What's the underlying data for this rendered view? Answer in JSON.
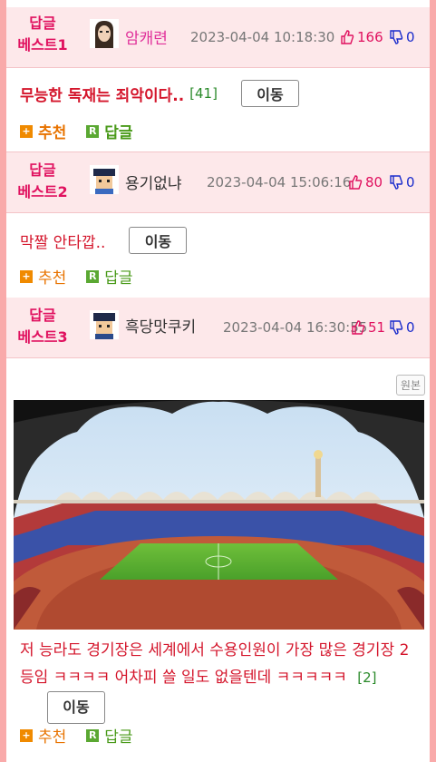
{
  "posts": [
    {
      "rank": [
        "답글",
        "베스트1"
      ],
      "nick": "암캐련",
      "date": "2023-04-04 10:18:30",
      "likes": "166",
      "dislikes": "0",
      "title": "무능한 독재는 죄악이다..",
      "comment_count": "[41]",
      "move_label": "이동",
      "recommend_label": "추천",
      "reply_label": "답글"
    },
    {
      "rank": [
        "답글",
        "베스트2"
      ],
      "nick": "용기없냐",
      "date": "2023-04-04 15:06:16",
      "likes": "80",
      "dislikes": "0",
      "title": "막짤 안타깝..",
      "move_label": "이동",
      "recommend_label": "추천",
      "reply_label": "답글"
    },
    {
      "rank": [
        "답글",
        "베스트3"
      ],
      "nick": "흑당맛쿠키",
      "date": "2023-04-04 16:30:55",
      "likes": "51",
      "dislikes": "0",
      "original_label": "원본",
      "body": "저 능라도 경기장은 세계에서 수용인원이 가장 많은 경기장 2등임 ㅋㅋㅋㅋ 어차피 쓸 일도 없을텐데 ㅋㅋㅋㅋㅋ",
      "comment_count": "[2]",
      "move_label": "이동",
      "recommend_label": "추천",
      "reply_label": "답글"
    }
  ],
  "colors": {
    "frame": "#f9aaaa",
    "header_bg": "#fde8ea",
    "accent": "#e0115f",
    "title": "#d4152b",
    "recommend": "#e87300",
    "reply": "#4a9a1a",
    "dislike": "#1a2ccc"
  },
  "icons": [
    "thumbs-up-icon",
    "thumbs-down-icon",
    "plus-icon",
    "reply-r-icon"
  ]
}
